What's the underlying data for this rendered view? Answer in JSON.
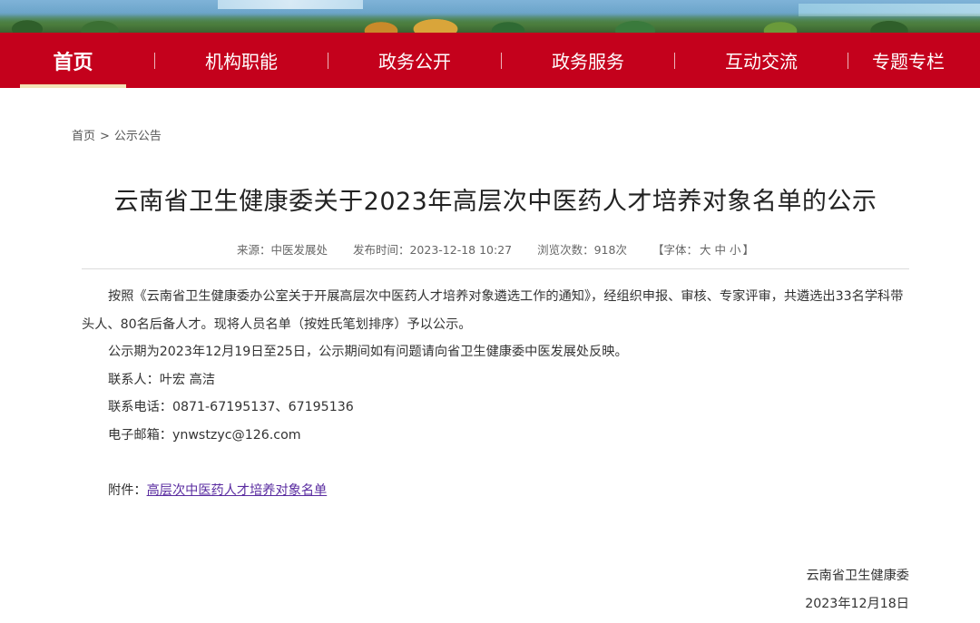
{
  "nav": {
    "items": [
      {
        "label": "首页",
        "active": true
      },
      {
        "label": "机构职能"
      },
      {
        "label": "政务公开"
      },
      {
        "label": "政务服务"
      },
      {
        "label": "互动交流"
      },
      {
        "label": "专题专栏"
      }
    ]
  },
  "breadcrumb": {
    "home": "首页",
    "separator": ">",
    "current": "公示公告"
  },
  "article": {
    "title": "云南省卫生健康委关于2023年高层次中医药人才培养对象名单的公示",
    "meta": {
      "source": "来源：中医发展处",
      "published": "发布时间：2023-12-18 10:27",
      "views": "浏览次数：918次",
      "font_size_prefix": "【字体：",
      "font_large": "大",
      "font_medium": "中",
      "font_small": "小",
      "font_size_suffix": "】"
    },
    "paragraphs": [
      "按照《云南省卫生健康委办公室关于开展高层次中医药人才培养对象遴选工作的通知》，经组织申报、审核、专家评审，共遴选出33名学科带头人、80名后备人才。现将人员名单（按姓氏笔划排序）予以公示。",
      "公示期为2023年12月19日至25日，公示期间如有问题请向省卫生健康委中医发展处反映。",
      "联系人：叶宏 高洁",
      "联系电话：0871-67195137、67195136",
      "电子邮箱：ynwstzyc@126.com"
    ],
    "attachment_label": "附件：",
    "attachment_link": "高层次中医药人才培养对象名单",
    "signature_org": "云南省卫生健康委",
    "signature_date": "2023年12月18日"
  },
  "colors": {
    "nav_bg": "#c4011c",
    "nav_active_underline": "#f3e2b6",
    "link": "#5a2ca0"
  }
}
